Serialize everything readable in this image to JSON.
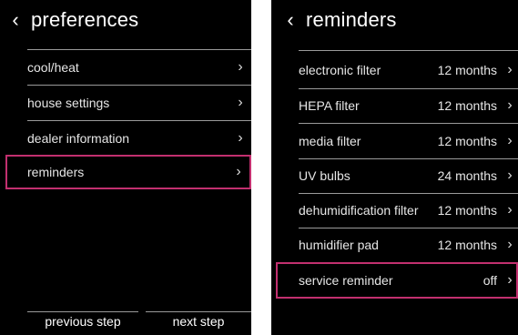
{
  "left": {
    "title": "preferences",
    "items": [
      {
        "label": "cool/heat"
      },
      {
        "label": "house settings"
      },
      {
        "label": "dealer information"
      },
      {
        "label": "reminders",
        "selected": true
      }
    ],
    "footer": {
      "previous": "previous step",
      "next": "next step"
    }
  },
  "right": {
    "title": "reminders",
    "items": [
      {
        "label": "electronic filter",
        "value": "12 months"
      },
      {
        "label": "HEPA filter",
        "value": "12 months"
      },
      {
        "label": "media filter",
        "value": "12 months"
      },
      {
        "label": "UV bulbs",
        "value": "24 months"
      },
      {
        "label": "dehumidification filter",
        "value": "12 months"
      },
      {
        "label": "humidifier pad",
        "value": "12 months"
      },
      {
        "label": "service reminder",
        "value": "off",
        "selected": true
      }
    ]
  },
  "colors": {
    "background": "#000000",
    "divider": "#9a9a9a",
    "highlight": "#c2306f",
    "text": "#ffffff"
  },
  "icons": {
    "back": "chevron-left-icon",
    "row": "chevron-right-icon"
  }
}
